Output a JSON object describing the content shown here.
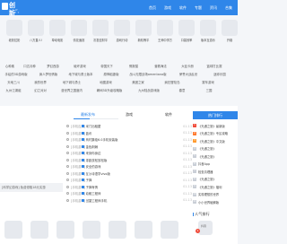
{
  "header": {
    "logo_text": "创新",
    "logo_sub": "C X W . N E T",
    "nav": [
      "首页",
      "游戏",
      "软件",
      "专题",
      "资讯",
      "合集"
    ]
  },
  "apps": [
    "老奶拉奶",
    "八方直人!",
    "草动电影",
    "情花面赛",
    "次发信财平",
    "游戏行动",
    "新机等平",
    "王师中学方",
    "口袋效率",
    "版本互游乐",
    "开卷"
  ],
  "tag_rows": [
    [
      "心种素",
      "口达月种",
      "梦幻西游",
      "破坏游戏",
      "帝国天下",
      "情报猫",
      "营救海法",
      "大钻卡册",
      "篮球打比赛"
    ],
    [
      "手绘的3D游戏版",
      "疯人梦世情版",
      "地下城与勇士版本",
      "原神稻妻版",
      "战斗无限战场amentana版",
      "荣誉大战乱世",
      "迷你乐园"
    ],
    [
      "天地三川",
      "我的世界",
      "地下城与勇士",
      "地图游戏",
      "美团之家",
      "疯狂冒险岛",
      "赛车游戏"
    ],
    [
      "九州江湖组",
      "幻之对对",
      "漫世界之国度内",
      "瞬间3D升级攻略版",
      "九州陆战游戏版",
      "春意",
      "三国"
    ]
  ],
  "left_ad": "[科学幻游戏] 免费领取18元实惠",
  "tabs": {
    "news": "最新发布",
    "games": "游戏",
    "software": "软件"
  },
  "news": [
    {
      "cat": "[手机应用]",
      "title": "米门出租屋",
      "date": "01-13"
    },
    {
      "cat": "[手机游戏]",
      "title": "蓝讯",
      "date": "01-13"
    },
    {
      "cat": "[手机游戏]",
      "title": "商村集临6.0手机安装版",
      "date": "01-13"
    },
    {
      "cat": "[手机游戏]",
      "title": "金色荆棘",
      "date": "01-13"
    },
    {
      "cat": "[手机游戏]",
      "title": "来到你身边",
      "date": "01-13"
    },
    {
      "cat": "[手机游戏]",
      "title": "零距放松放松版",
      "date": "01-13"
    },
    {
      "cat": "[手机游戏]",
      "title": "安全的游戏",
      "date": "01-13"
    },
    {
      "cat": "[手机游戏]",
      "title": "互沙诗语学vivo版",
      "date": "01-13"
    },
    {
      "cat": "[手机游戏]",
      "title": "子弹",
      "date": "01-13"
    },
    {
      "cat": "[手机游戏]",
      "title": "子弹有情",
      "date": "01-13"
    },
    {
      "cat": "[手机游戏]",
      "title": "幼稚工程师",
      "date": "01-13"
    },
    {
      "cat": "[手机游戏]",
      "title": "回望工程师手机",
      "date": "01-13"
    }
  ],
  "hot": {
    "title": "热门排行",
    "items": [
      {
        "num": "1",
        "text": "《光遇之旅》最新版"
      },
      {
        "num": "2",
        "text": "《光遇之旅》专区攻略"
      },
      {
        "num": "3",
        "text": "《光遇之旅》中文版"
      },
      {
        "num": "4",
        "text": "《光遇之旅》"
      },
      {
        "num": "5",
        "text": "《光遇之旅》"
      },
      {
        "num": "6",
        "text": "抖音App"
      },
      {
        "num": "7",
        "text": "检查清理器"
      },
      {
        "num": "8",
        "text": "《光遇之旅》"
      },
      {
        "num": "9",
        "text": "《光遇之旅》福利"
      },
      {
        "num": "10",
        "text": "实现理想的世界"
      },
      {
        "num": "11",
        "text": "小小世界破解版"
      }
    ]
  },
  "ranking": {
    "title": "人气排行",
    "first_badge": "1",
    "first_name": "抖音"
  },
  "colors": {
    "brand": "#2f86e9",
    "hot_top": "#f04b3a",
    "hot_mid": "#ff9b2f",
    "hot_low": "#c9ced6"
  }
}
